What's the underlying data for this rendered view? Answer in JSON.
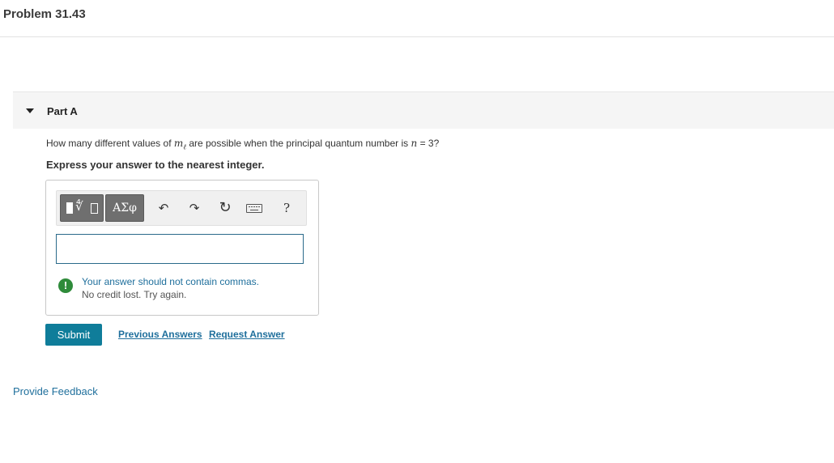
{
  "page": {
    "title": "Problem 31.43"
  },
  "part": {
    "label": "Part A",
    "question_before": "How many different values of ",
    "question_var": "m",
    "question_var_sub": "ℓ",
    "question_middle": " are possible when the principal quantum number is ",
    "question_n": "n",
    "question_after": " = 3?",
    "instruction": "Express your answer to the nearest integer."
  },
  "toolbar": {
    "symbols_label": "ΑΣφ",
    "templates_icon": "templates-icon",
    "undo_icon": "undo-icon",
    "redo_icon": "redo-icon",
    "reset_icon": "reset-icon",
    "keyboard_icon": "keyboard-icon",
    "help_label": "?"
  },
  "answer": {
    "value": ""
  },
  "feedback_message": {
    "icon_glyph": "!",
    "message": "Your answer should not contain commas.",
    "sub_message": "No credit lost. Try again."
  },
  "actions": {
    "submit_label": "Submit",
    "previous_answers_label": "Previous Answers",
    "request_answer_label": "Request Answer"
  },
  "footer": {
    "provide_feedback_label": "Provide Feedback"
  },
  "colors": {
    "accent": "#0f7d9a",
    "link": "#1f6f9c",
    "warning_icon": "#2e8b3a"
  }
}
